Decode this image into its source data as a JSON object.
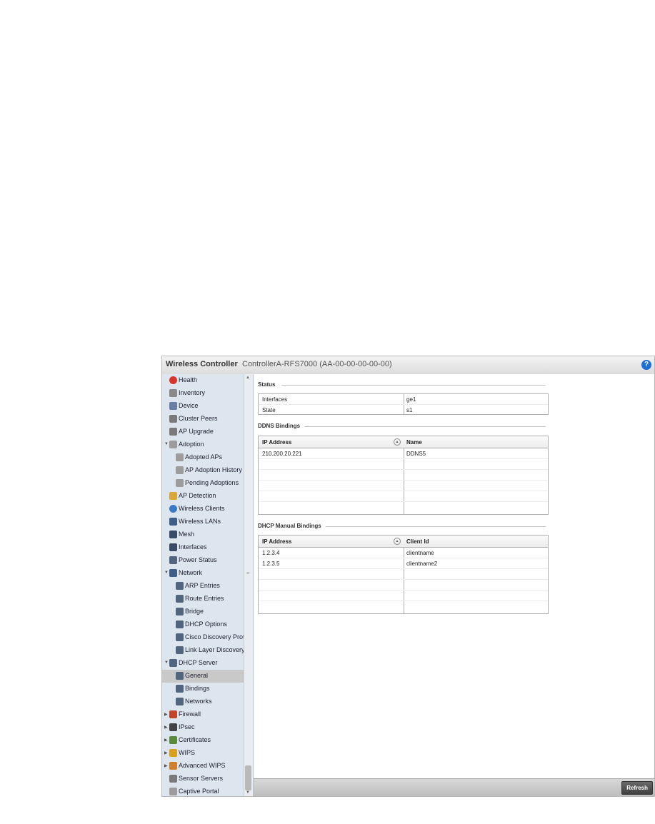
{
  "header": {
    "app_title": "Wireless Controller",
    "device_title": "ControllerA-RFS7000 (AA-00-00-00-00-00)",
    "help_icon": "?"
  },
  "sidebar": {
    "items": [
      {
        "label": "Health",
        "icon": "health-icon",
        "color": "#d9342b"
      },
      {
        "label": "Inventory",
        "icon": "inventory-icon",
        "color": "#8a8a8a"
      },
      {
        "label": "Device",
        "icon": "device-icon",
        "color": "#6a7fa5"
      },
      {
        "label": "Cluster Peers",
        "icon": "cluster-peers-icon",
        "color": "#7a7a7a"
      },
      {
        "label": "AP Upgrade",
        "icon": "ap-upgrade-icon",
        "color": "#7a7a7a"
      },
      {
        "label": "Adoption",
        "icon": "adoption-icon",
        "color": "#9c9c9c"
      },
      {
        "label": "Adopted APs",
        "icon": "adopted-aps-icon",
        "color": "#9c9c9c"
      },
      {
        "label": "AP Adoption History",
        "icon": "ap-adoption-history-icon",
        "color": "#9c9c9c"
      },
      {
        "label": "Pending Adoptions",
        "icon": "pending-adoptions-icon",
        "color": "#9c9c9c"
      },
      {
        "label": "AP Detection",
        "icon": "ap-detection-icon",
        "color": "#d8a63a"
      },
      {
        "label": "Wireless Clients",
        "icon": "wireless-clients-icon",
        "color": "#3a79c8"
      },
      {
        "label": "Wireless LANs",
        "icon": "wireless-lans-icon",
        "color": "#3f5f88"
      },
      {
        "label": "Mesh",
        "icon": "mesh-icon",
        "color": "#3a4b66"
      },
      {
        "label": "Interfaces",
        "icon": "interfaces-icon",
        "color": "#3a4b66"
      },
      {
        "label": "Power Status",
        "icon": "power-status-icon",
        "color": "#52657f"
      },
      {
        "label": "Network",
        "icon": "network-icon",
        "color": "#3f5f88"
      },
      {
        "label": "ARP Entries",
        "icon": "arp-entries-icon",
        "color": "#52657f"
      },
      {
        "label": "Route Entries",
        "icon": "route-entries-icon",
        "color": "#52657f"
      },
      {
        "label": "Bridge",
        "icon": "bridge-icon",
        "color": "#52657f"
      },
      {
        "label": "DHCP Options",
        "icon": "dhcp-options-icon",
        "color": "#52657f"
      },
      {
        "label": "Cisco Discovery Prot",
        "icon": "cisco-discovery-icon",
        "color": "#52657f"
      },
      {
        "label": "Link Layer Discovery",
        "icon": "link-layer-discovery-icon",
        "color": "#52657f"
      },
      {
        "label": "DHCP Server",
        "icon": "dhcp-server-icon",
        "color": "#52657f"
      },
      {
        "label": "General",
        "icon": "general-icon",
        "color": "#52657f"
      },
      {
        "label": "Bindings",
        "icon": "bindings-icon",
        "color": "#52657f"
      },
      {
        "label": "Networks",
        "icon": "networks-icon",
        "color": "#52657f"
      },
      {
        "label": "Firewall",
        "icon": "firewall-icon",
        "color": "#c0452a"
      },
      {
        "label": "IPsec",
        "icon": "ipsec-icon",
        "color": "#444444"
      },
      {
        "label": "Certificates",
        "icon": "certificates-icon",
        "color": "#5b8a3a"
      },
      {
        "label": "WIPS",
        "icon": "wips-icon",
        "color": "#d9a020"
      },
      {
        "label": "Advanced WIPS",
        "icon": "advanced-wips-icon",
        "color": "#d0802a"
      },
      {
        "label": "Sensor Servers",
        "icon": "sensor-servers-icon",
        "color": "#7a7a7a"
      },
      {
        "label": "Captive Portal",
        "icon": "captive-portal-icon",
        "color": "#9c9c9c"
      }
    ]
  },
  "status": {
    "title": "Status",
    "rows": [
      {
        "label": "Interfaces",
        "value": "ge1"
      },
      {
        "label": "State",
        "value": "s1"
      }
    ]
  },
  "ddns": {
    "title": "DDNS Bindings",
    "columns": [
      "IP Address",
      "Name"
    ],
    "rows": [
      {
        "ip": "210.200.20.221",
        "name": "DDNS5"
      }
    ]
  },
  "dhcp_manual": {
    "title": "DHCP Manual Bindings",
    "columns": [
      "IP Address",
      "Client Id"
    ],
    "rows": [
      {
        "ip": "1.2.3.4",
        "client": "clientname"
      },
      {
        "ip": "1.2.3.5",
        "client": "clientname2"
      }
    ]
  },
  "footer": {
    "refresh_label": "Refresh"
  }
}
